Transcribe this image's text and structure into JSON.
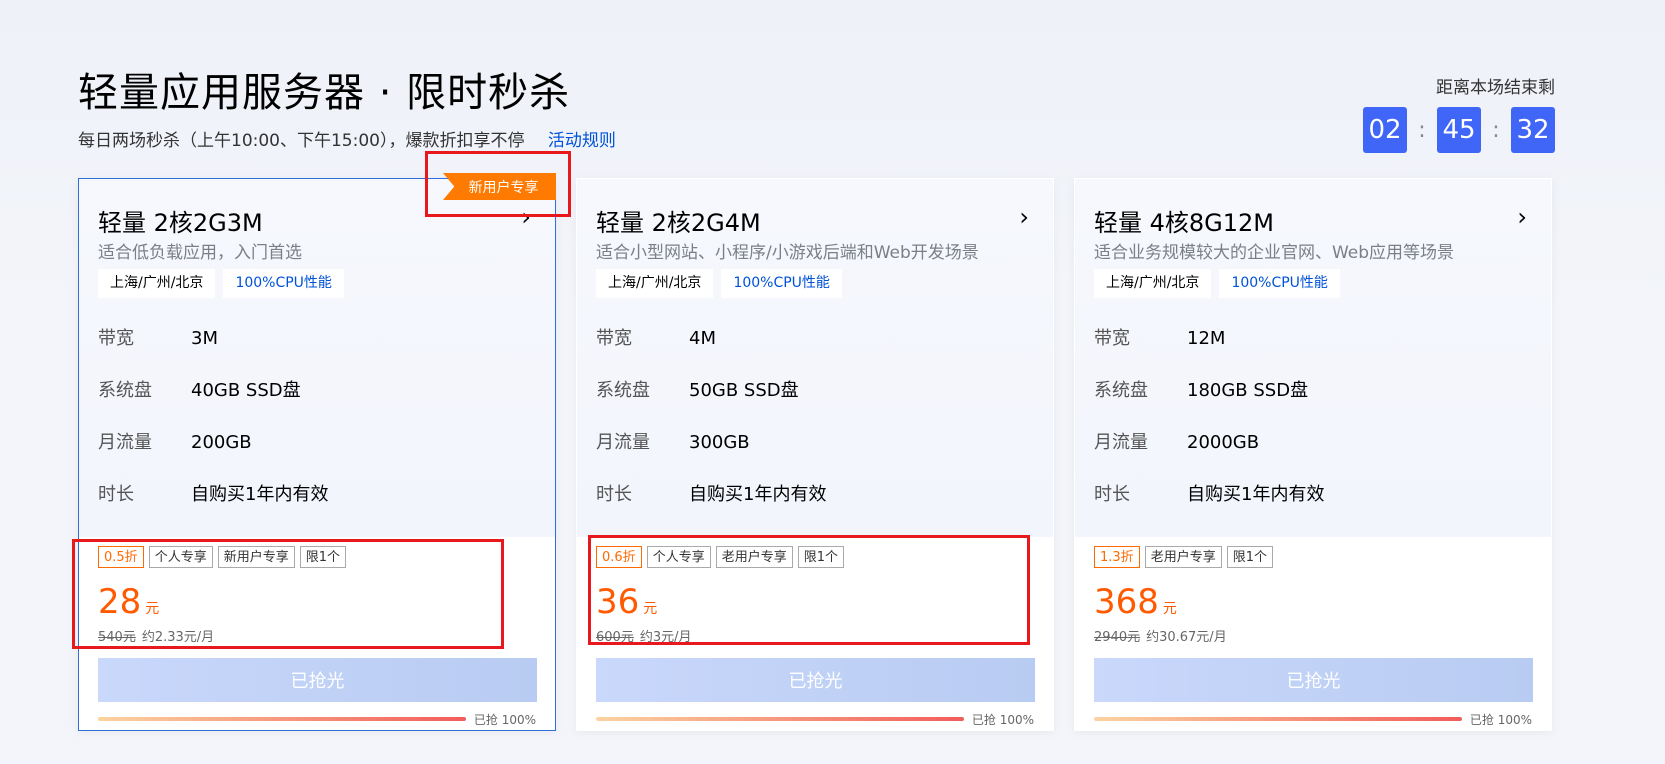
{
  "header": {
    "title": "轻量应用服务器 · 限时秒杀",
    "subtitle": "每日两场秒杀（上午10:00、下午15:00），爆款折扣享不停",
    "rules_link": "活动规则"
  },
  "countdown": {
    "label": "距离本场结束剩",
    "hours": "02",
    "minutes": "45",
    "seconds": "32",
    "sep": ":"
  },
  "ribbon": "新用户专享",
  "spec_labels": {
    "bandwidth": "带宽",
    "disk": "系统盘",
    "traffic": "月流量",
    "duration": "时长"
  },
  "cards": [
    {
      "name": "轻量 2核2G3M",
      "desc": "适合低负载应用，入门首选",
      "tags": [
        "上海/广州/北京",
        "100%CPU性能"
      ],
      "bandwidth": "3M",
      "disk": "40GB SSD盘",
      "traffic": "200GB",
      "duration": "自购买1年内有效",
      "badges": [
        "0.5折",
        "个人专享",
        "新用户专享",
        "限1个"
      ],
      "price": "28",
      "price_unit": "元",
      "orig_price": "540元",
      "monthly": "约2.33元/月",
      "button": "已抢光",
      "progress_label": "已抢 100%",
      "progress": 1.0
    },
    {
      "name": "轻量 2核2G4M",
      "desc": "适合小型网站、小程序/小游戏后端和Web开发场景",
      "tags": [
        "上海/广州/北京",
        "100%CPU性能"
      ],
      "bandwidth": "4M",
      "disk": "50GB SSD盘",
      "traffic": "300GB",
      "duration": "自购买1年内有效",
      "badges": [
        "0.6折",
        "个人专享",
        "老用户专享",
        "限1个"
      ],
      "price": "36",
      "price_unit": "元",
      "orig_price": "600元",
      "monthly": "约3元/月",
      "button": "已抢光",
      "progress_label": "已抢 100%",
      "progress": 1.0
    },
    {
      "name": "轻量 4核8G12M",
      "desc": "适合业务规模较大的企业官网、Web应用等场景",
      "tags": [
        "上海/广州/北京",
        "100%CPU性能"
      ],
      "bandwidth": "12M",
      "disk": "180GB SSD盘",
      "traffic": "2000GB",
      "duration": "自购买1年内有效",
      "badges": [
        "1.3折",
        "老用户专享",
        "限1个"
      ],
      "price": "368",
      "price_unit": "元",
      "orig_price": "2940元",
      "monthly": "约30.67元/月",
      "button": "已抢光",
      "progress_label": "已抢 100%",
      "progress": 1.0
    }
  ],
  "colors": {
    "accent_blue": "#3f66f7",
    "link_blue": "#0052d9",
    "price_orange": "#ff5a00",
    "ribbon_orange": "#ff7a00",
    "highlight_red": "#e8191c"
  }
}
